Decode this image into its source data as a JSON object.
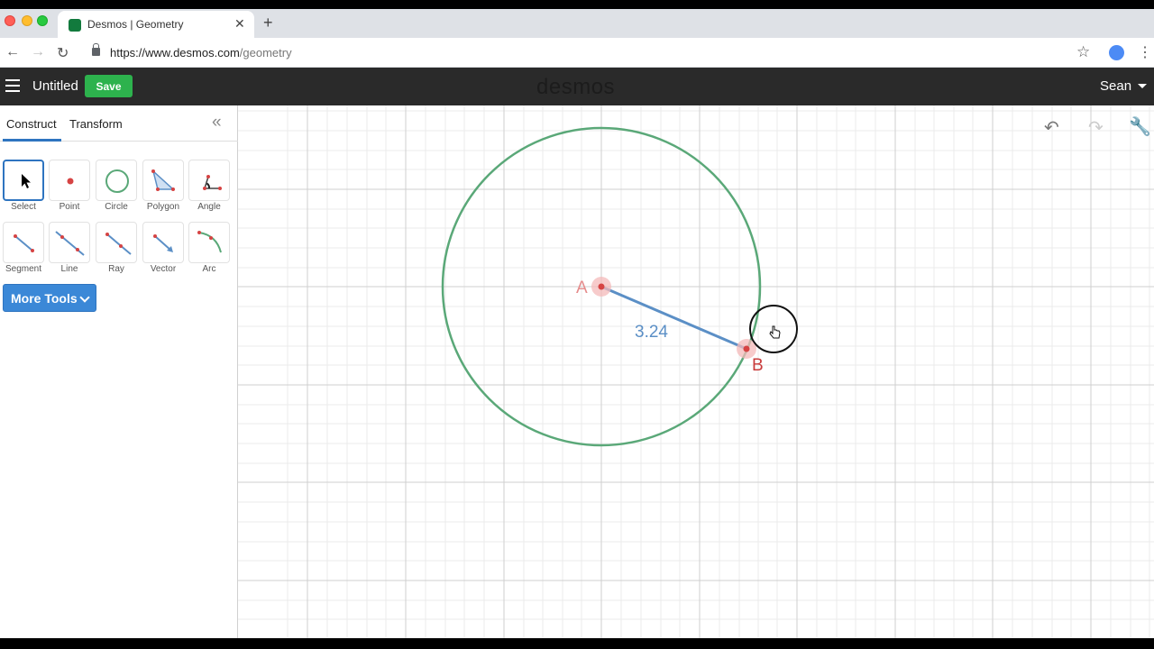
{
  "browser": {
    "tab_title": "Desmos | Geometry",
    "url_host": "https://www.desmos.com",
    "url_path": "/geometry"
  },
  "header": {
    "doc_title": "Untitled",
    "save_label": "Save",
    "brand": "desmos",
    "user_name": "Sean"
  },
  "sidebar": {
    "tabs": [
      "Construct",
      "Transform"
    ],
    "active_tab": "Construct",
    "tools": [
      {
        "label": "Select",
        "icon": "cursor-icon",
        "selected": true
      },
      {
        "label": "Point",
        "icon": "point-icon"
      },
      {
        "label": "Circle",
        "icon": "circle-icon"
      },
      {
        "label": "Polygon",
        "icon": "polygon-icon"
      },
      {
        "label": "Angle",
        "icon": "angle-icon"
      },
      {
        "label": "Segment",
        "icon": "segment-icon"
      },
      {
        "label": "Line",
        "icon": "line-icon"
      },
      {
        "label": "Ray",
        "icon": "ray-icon"
      },
      {
        "label": "Vector",
        "icon": "vector-icon"
      },
      {
        "label": "Arc",
        "icon": "arc-icon"
      }
    ],
    "more_tools_label": "More Tools"
  },
  "canvas": {
    "point_a_label": "A",
    "point_b_label": "B",
    "segment_length": "3.24",
    "colors": {
      "circle": "#5aa878",
      "segment": "#5b8fc6",
      "point": "#d64343",
      "point_halo": "#f4b9b9"
    }
  }
}
